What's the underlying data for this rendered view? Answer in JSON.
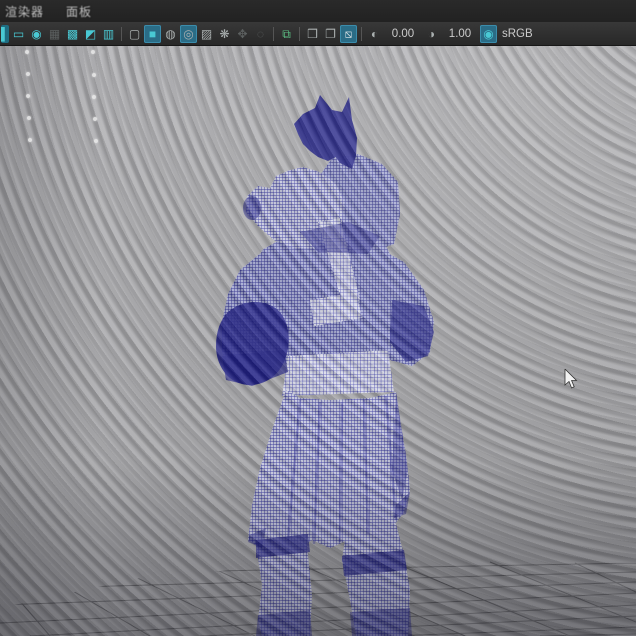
{
  "menu": {
    "items": [
      {
        "label": "渲染器"
      },
      {
        "label": "面板"
      }
    ]
  },
  "toolbar": {
    "icons": [
      {
        "name": "partial-left-icon",
        "glyph": "▌"
      },
      {
        "name": "camera-icon",
        "glyph": "▭"
      },
      {
        "name": "film-gate-icon",
        "glyph": "◉"
      },
      {
        "name": "resolution-gate-icon",
        "glyph": "▦"
      },
      {
        "name": "gate-mask-icon",
        "glyph": "▩"
      },
      {
        "name": "field-chart-icon",
        "glyph": "◩"
      },
      {
        "name": "safe-title-icon",
        "glyph": "▥"
      },
      {
        "name": "wireframe-mode-icon",
        "glyph": "▢"
      },
      {
        "name": "shaded-mode-icon",
        "glyph": "■",
        "state": "active"
      },
      {
        "name": "textured-mode-icon",
        "glyph": "◍"
      },
      {
        "name": "lights-mode-icon",
        "glyph": "◎",
        "state": "active"
      },
      {
        "name": "shadows-icon",
        "glyph": "▨"
      },
      {
        "name": "ambient-occlusion-icon",
        "glyph": "❋"
      },
      {
        "name": "motion-blur-icon",
        "glyph": "✥"
      },
      {
        "name": "anti-alias-icon",
        "glyph": "◌"
      },
      {
        "name": "isolate-select-icon",
        "glyph": "⧉"
      },
      {
        "name": "xray-icon",
        "glyph": "❒"
      },
      {
        "name": "xray-joints-icon",
        "glyph": "❐"
      },
      {
        "name": "xray-active-icon",
        "glyph": "⧅",
        "state": "active"
      },
      {
        "name": "exposure-icon",
        "glyph": "◐"
      },
      {
        "name": "gamma-icon",
        "glyph": "◑"
      },
      {
        "name": "view-transform-icon",
        "glyph": "◉",
        "state": "active"
      }
    ],
    "exposure_value": "0.00",
    "gamma_value": "1.00",
    "view_transform_label": "sRGB"
  },
  "viewport": {
    "cursor": "arrow",
    "reflection_dots": {
      "columns": 2,
      "rows": 5
    },
    "colors": {
      "accent_teal": "#49c9d4",
      "active_highlight": "#2a6c86",
      "isolate_green": "#5cc084",
      "wireframe_blue": "#1c1c96",
      "wireframe_solid": "#13137e",
      "viewport_gray": "#a3a3a5",
      "grid_line": "#4d4d4f",
      "menubar_bg": "#262626",
      "toolbar_bg": "#2e2e2e"
    }
  }
}
